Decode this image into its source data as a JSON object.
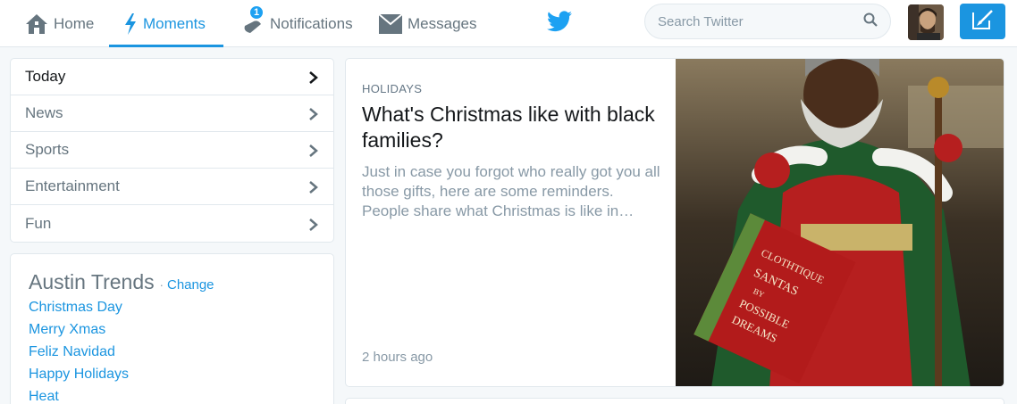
{
  "nav": {
    "home": "Home",
    "moments": "Moments",
    "notifications": "Notifications",
    "notifications_count": "1",
    "messages": "Messages"
  },
  "search": {
    "placeholder": "Search Twitter"
  },
  "menu": {
    "items": [
      {
        "label": "Today"
      },
      {
        "label": "News"
      },
      {
        "label": "Sports"
      },
      {
        "label": "Entertainment"
      },
      {
        "label": "Fun"
      }
    ]
  },
  "trends": {
    "title": "Austin Trends",
    "change": "Change",
    "items": [
      "Christmas Day",
      "Merry Xmas",
      "Feliz Navidad",
      "Happy Holidays",
      "Heat"
    ]
  },
  "moment": {
    "category": "HOLIDAYS",
    "title": "What's Christmas like with black families?",
    "description": "Just in case you forgot who really got you all those gifts, here are some reminders. People share what Christmas is like in…",
    "time": "2 hours ago",
    "book_text": "Clothtique Santas by Possible Dreams"
  },
  "colors": {
    "accent": "#1b95e0",
    "muted": "#66757f"
  }
}
